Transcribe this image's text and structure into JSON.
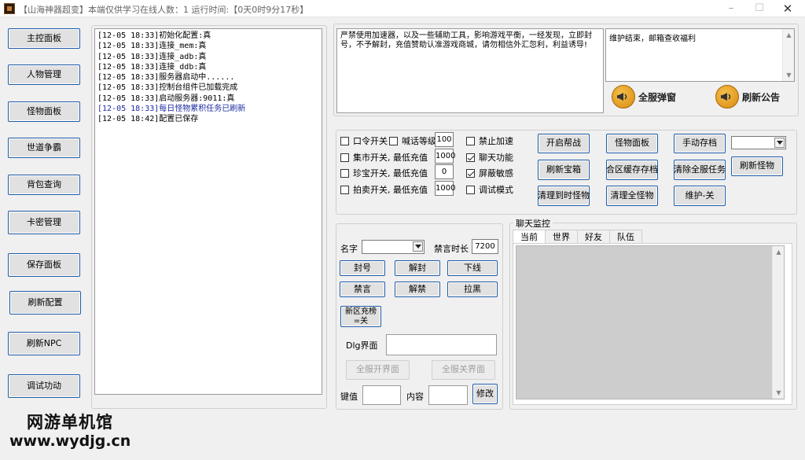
{
  "window": {
    "title": "【山海神器超变】本端仅供学习在线人数：1  运行时间:【0天0时9分17秒】"
  },
  "sidebar": {
    "items": [
      "主控面板",
      "人物管理",
      "怪物面板",
      "世道争霸",
      "背包查询",
      "卡密管理",
      "保存面板",
      "刷新配置",
      "刷新NPC",
      "调试功动"
    ]
  },
  "log": {
    "lines": [
      "[12-05 18:33]初始化配置:真",
      "[12-05 18:33]连接_mem:真",
      "[12-05 18:33]连接_adb:真",
      "[12-05 18:33]连接_ddb:真",
      "[12-05 18:33]服务器启动中......",
      "[12-05 18:33]控制台组件已加载完成",
      "[12-05 18:33]启动服务器:9011:真",
      "[12-05 18:33]每日怪物累积任务已刷新",
      "[12-05 18:42]配置已保存"
    ]
  },
  "notice": {
    "text": "严禁使用加速器，以及一些辅助工具，影响游戏平衡，一经发现，立即封号，不予解封，充值赞助认准游戏商城，请勿相信外汇忽利，利益诱导!"
  },
  "mail": {
    "text": "维护结束，邮箱查收福利",
    "broadcast_label": "全服弹窗",
    "refresh_notice_label": "刷新公告"
  },
  "settings": {
    "command_switch": "口令开关",
    "shout_level": "喊话等级",
    "shout_level_value": "100",
    "market_switch": "集市开关, 最低充值",
    "market_value": "1000",
    "treasure_switch": "珍宝开关, 最低充值",
    "treasure_value": "0",
    "auction_switch": "拍卖开关, 最低充值",
    "auction_value": "1000",
    "ban_speedup": "禁止加速",
    "chat_function": "聊天功能",
    "block_sensitive": "屏蔽敏感",
    "debug_mode": "调试模式"
  },
  "actions": {
    "open_guild_war": "开启帮战",
    "monster_panel": "怪物面板",
    "manual_save": "手动存档",
    "refresh_chest": "刷新宝箱",
    "merge_cache_save": "合区缓存存档",
    "clear_all_tasks": "清除全服任务",
    "refresh_monster": "刷新怪物",
    "clear_timed_monster": "清理到时怪物",
    "clear_all_monster": "清理全怪物",
    "maintenance": "维护-关"
  },
  "player_panel": {
    "name_label": "名字",
    "mute_duration_label": "禁言时长",
    "mute_duration_value": "7200",
    "ban_account": "封号",
    "unban": "解封",
    "kick_offline": "下线",
    "mute": "禁言",
    "unmute": "解禁",
    "blacklist": "拉黑",
    "new_zone_recharge_line1": "新区充榜",
    "new_zone_recharge_line2": "=关",
    "dlg_label": "Dlg界面",
    "open_all_ui": "全服开界面",
    "close_all_ui": "全服关界面",
    "key_label": "键值",
    "content_label": "内容",
    "modify": "修改"
  },
  "chat_monitor": {
    "title": "聊天监控",
    "tabs": [
      "当前",
      "世界",
      "好友",
      "队伍"
    ]
  },
  "watermark": {
    "line1": "网游单机馆",
    "line2": "www.wydjg.cn"
  }
}
